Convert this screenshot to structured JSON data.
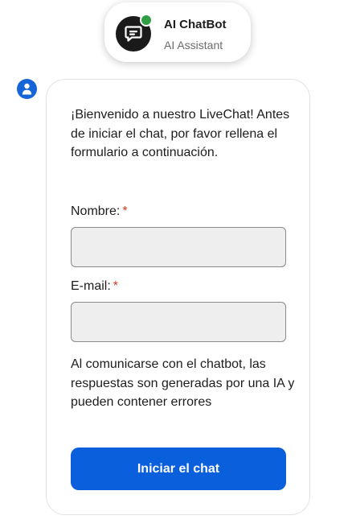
{
  "header": {
    "bot_name": "AI ChatBot",
    "bot_role": "AI Assistant",
    "avatar_icon": "chat-bubble-icon",
    "status_icon": "online-dot",
    "status_color": "#2f9e44"
  },
  "message": {
    "sender_icon": "user-icon",
    "welcome_text": "¡Bienvenido a nuestro LiveChat! Antes de iniciar el chat, por favor rellena el formulario a continuación.",
    "form": {
      "name_label": "Nombre:",
      "name_required_mark": "*",
      "name_value": "",
      "email_label": "E-mail:",
      "email_required_mark": "*",
      "email_value": ""
    },
    "disclaimer": "Al comunicarse con el chatbot, las respuestas son generadas por una IA y pueden contener errores",
    "start_button_label": "Iniciar el chat"
  },
  "colors": {
    "accent": "#0a5fdc",
    "required": "#d63a1e"
  }
}
